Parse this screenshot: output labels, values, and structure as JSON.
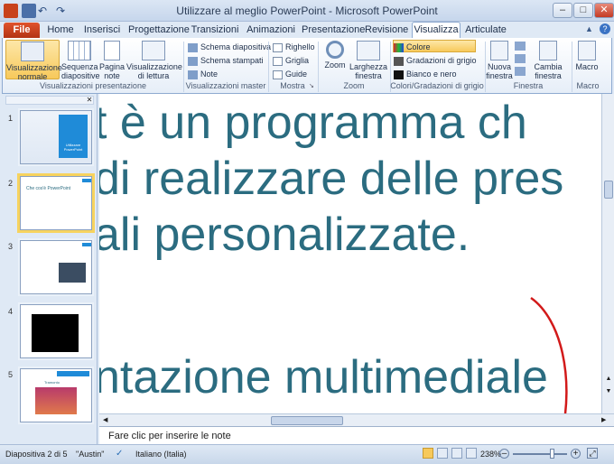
{
  "window": {
    "title": "Utilizzare al meglio PowerPoint - Microsoft PowerPoint"
  },
  "tabs": {
    "file": "File",
    "items": [
      "Home",
      "Inserisci",
      "Progettazione",
      "Transizioni",
      "Animazioni",
      "Presentazione",
      "Revisione",
      "Visualizza",
      "Articulate"
    ],
    "active": "Visualizza"
  },
  "ribbon": {
    "views": {
      "normal": "Visualizzazione normale",
      "slide_sorter": "Sequenza diapositive",
      "notes_page": "Pagina note",
      "reading": "Visualizzazione di lettura",
      "group": "Visualizzazioni presentazione"
    },
    "master": {
      "slide_master": "Schema diapositiva",
      "handout_master": "Schema stampati",
      "notes_master": "Note",
      "group": "Visualizzazioni master"
    },
    "show": {
      "ruler": "Righello",
      "grid": "Griglia",
      "guides": "Guide",
      "group": "Mostra"
    },
    "zoom": {
      "zoom": "Zoom",
      "fit": "Larghezza finestra",
      "group": "Zoom"
    },
    "color": {
      "color": "Colore",
      "gray": "Gradazioni di grigio",
      "bw": "Bianco e nero",
      "group": "Colori/Gradazioni di grigio"
    },
    "window": {
      "new": "Nuova finestra",
      "switch": "Cambia finestra",
      "group": "Finestra"
    },
    "macro": {
      "macro": "Macro",
      "group": "Macro"
    }
  },
  "thumbnails": [
    {
      "num": "1",
      "text": "Utilizzare PowerPoint"
    },
    {
      "num": "2",
      "text": "Che cos'è PowerPoint"
    },
    {
      "num": "3",
      "text": ""
    },
    {
      "num": "4",
      "text": ""
    },
    {
      "num": "5",
      "text": "Tramonto"
    }
  ],
  "slide": {
    "lines": [
      "t è un programma ch",
      "di realizzare delle pres",
      "ali personalizzate.",
      "ntazione multimediale"
    ]
  },
  "notes": {
    "placeholder": "Fare clic per inserire le note"
  },
  "status": {
    "slide": "Diapositiva 2 di 5",
    "theme": "\"Austin\"",
    "language": "Italiano (Italia)",
    "zoom": "238%"
  },
  "colors": {
    "accent_text": "#2b6c80",
    "file_tab": "#c23d1b",
    "selected_thumb": "#f7d35e"
  }
}
